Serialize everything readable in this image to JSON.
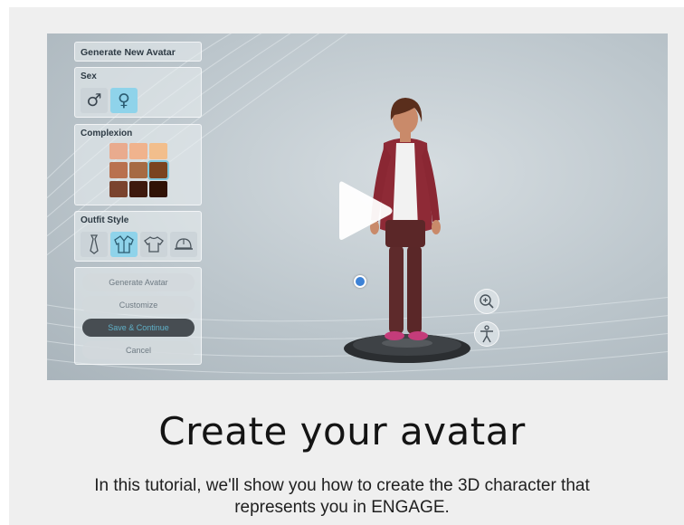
{
  "panel": {
    "title": "Generate New Avatar",
    "sex": {
      "label": "Sex",
      "options": [
        {
          "icon": "male-symbol-icon",
          "glyph": "♂",
          "selected": false
        },
        {
          "icon": "female-symbol-icon",
          "glyph": "♀",
          "selected": true
        }
      ]
    },
    "complexion": {
      "label": "Complexion",
      "swatches": [
        "#e9ab8e",
        "#f0b38d",
        "#f2be8c",
        "#b9714f",
        "#a66a43",
        "#7a4420",
        "#7a432e",
        "#3e1a0e",
        "#301206"
      ],
      "selected_index": 5
    },
    "outfit": {
      "label": "Outfit Style",
      "options": [
        {
          "icon": "tie-icon",
          "selected": false
        },
        {
          "icon": "jacket-icon",
          "selected": true
        },
        {
          "icon": "tshirt-icon",
          "selected": false
        },
        {
          "icon": "hardhat-icon",
          "selected": false
        }
      ]
    },
    "buttons": [
      "Generate Avatar",
      "Customize",
      "Save & Continue",
      "Cancel"
    ]
  },
  "overlay": {
    "play": "play-icon",
    "zoom": "zoom-in-icon",
    "pose": "person-icon"
  },
  "colors": {
    "accent": "#8fd3ea",
    "primary_button": "#474d52",
    "primary_button_text": "#5fb0c7"
  },
  "headline": "Create your avatar",
  "description": "In this tutorial, we'll show you how to create the 3D character that represents you in ENGAGE."
}
